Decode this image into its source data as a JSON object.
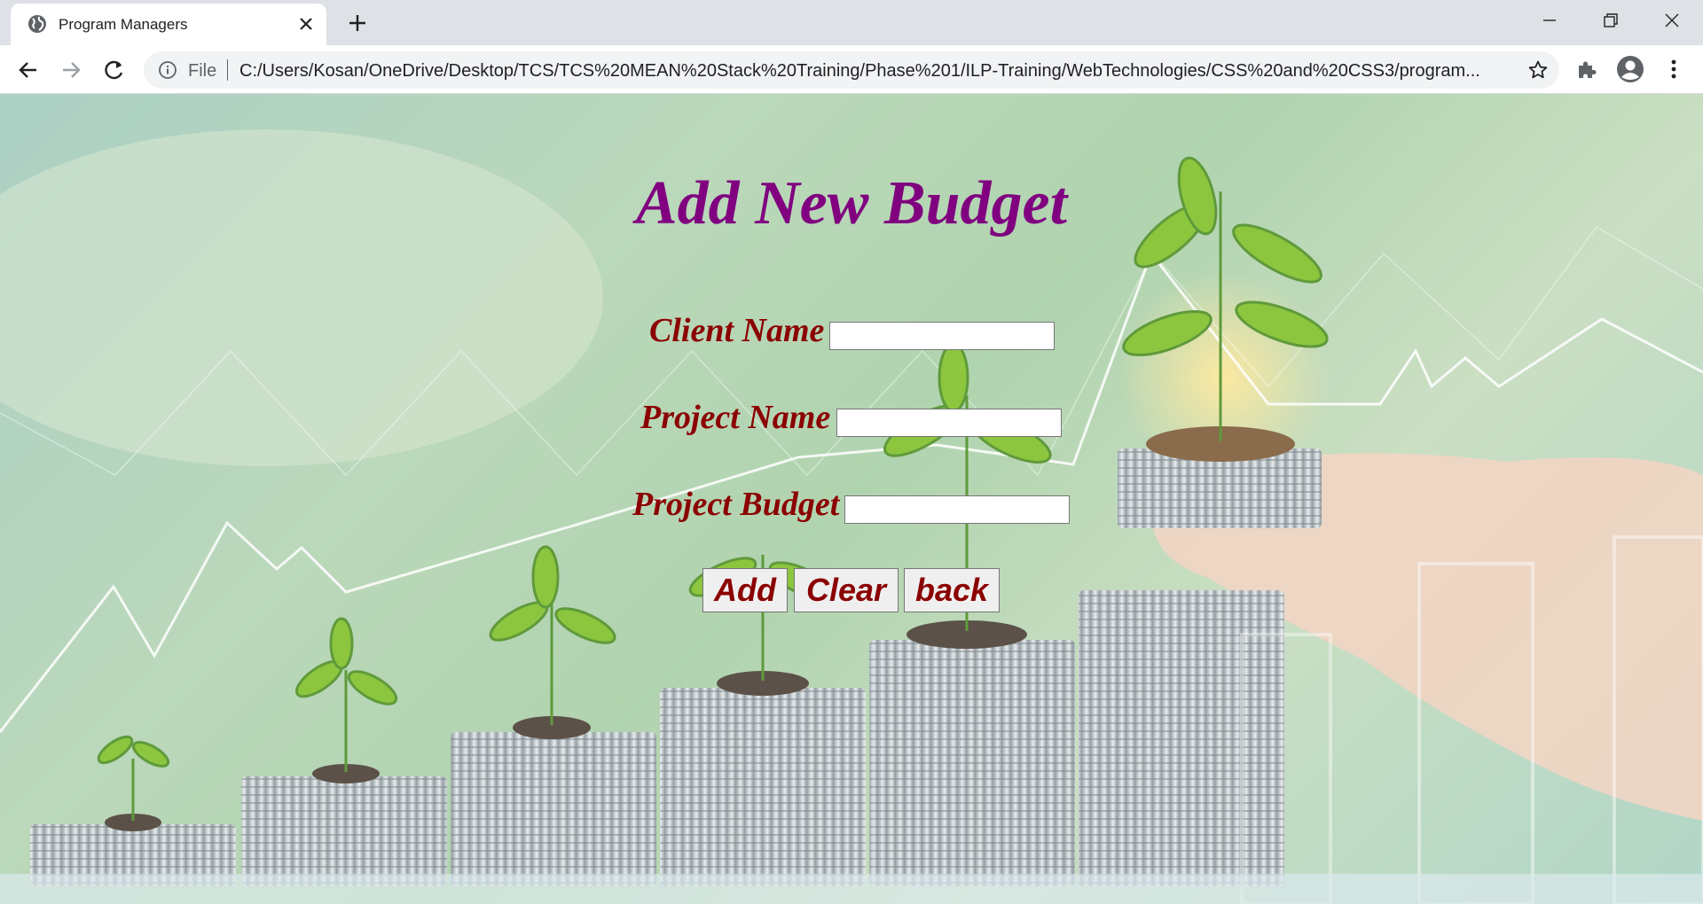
{
  "browser": {
    "tab": {
      "title": "Program Managers"
    },
    "address_bar": {
      "scheme_label": "File",
      "url": "C:/Users/Kosan/OneDrive/Desktop/TCS/TCS%20MEAN%20Stack%20Training/Phase%201/ILP-Training/WebTechnologies/CSS%20and%20CSS3/program..."
    },
    "icons": {
      "favicon": "globe-icon",
      "tab_close": "close-icon",
      "new_tab": "plus-icon",
      "minimize": "minimize-icon",
      "maximize": "restore-icon",
      "close": "close-icon",
      "back": "back-arrow-icon",
      "forward": "forward-arrow-icon",
      "reload": "reload-icon",
      "info": "info-icon",
      "bookmark": "star-icon",
      "extensions": "puzzle-icon",
      "profile": "account-icon",
      "menu": "kebab-menu-icon"
    }
  },
  "form": {
    "title": "Add New Budget",
    "fields": [
      {
        "label": "Client Name",
        "value": ""
      },
      {
        "label": "Project Name",
        "value": ""
      },
      {
        "label": "Project Budget",
        "value": ""
      }
    ],
    "buttons": {
      "add": "Add",
      "clear": "Clear",
      "back": "back"
    }
  },
  "colors": {
    "title": "#800080",
    "labels": "#8b0000",
    "button_text": "#8b0000"
  }
}
